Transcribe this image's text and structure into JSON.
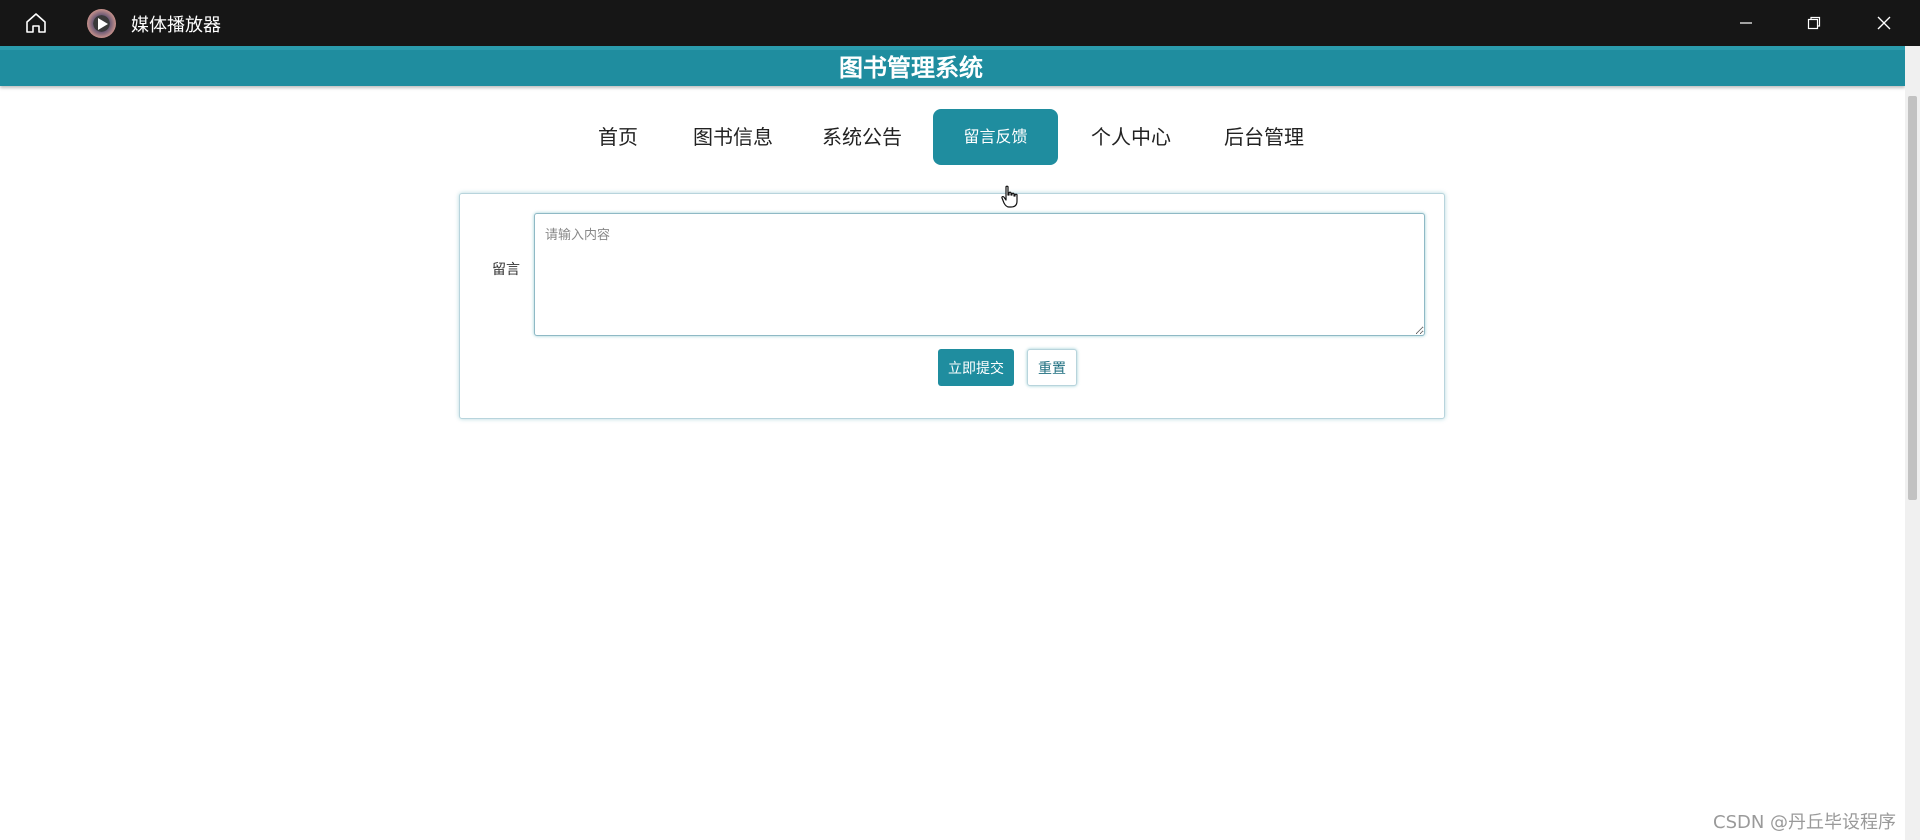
{
  "window": {
    "title": "媒体播放器",
    "icons": {
      "home": "home-icon",
      "app": "media-player-icon",
      "minimize": "minimize-icon",
      "maximize": "restore-icon",
      "close": "close-icon"
    }
  },
  "header": {
    "title": "图书管理系统"
  },
  "nav": {
    "items": [
      {
        "label": "首页"
      },
      {
        "label": "图书信息"
      },
      {
        "label": "系统公告"
      },
      {
        "label": "留言反馈",
        "active": true
      },
      {
        "label": "个人中心"
      },
      {
        "label": "后台管理"
      }
    ]
  },
  "form": {
    "label": "留言",
    "textarea": {
      "placeholder": "请输入内容",
      "value": ""
    },
    "submit_label": "立即提交",
    "reset_label": "重置"
  },
  "watermark": "CSDN @丹丘毕设程序",
  "colors": {
    "accent": "#1f8d9f",
    "titlebar": "#161616"
  }
}
